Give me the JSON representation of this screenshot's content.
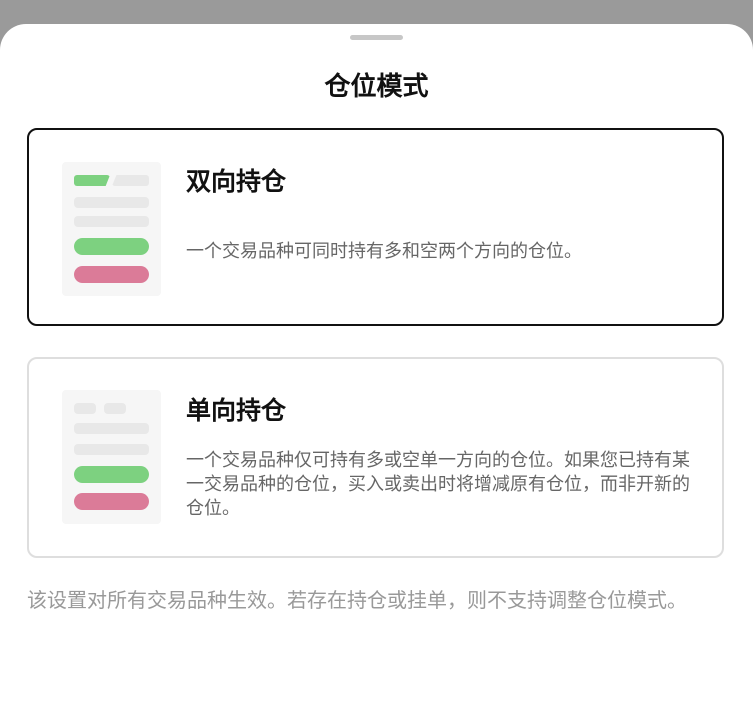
{
  "sheet": {
    "title": "仓位模式",
    "footnote": "该设置对所有交易品种生效。若存在持仓或挂单，则不支持调整仓位模式。"
  },
  "options": [
    {
      "title": "双向持仓",
      "description": "一个交易品种可同时持有多和空两个方向的仓位。",
      "selected": true
    },
    {
      "title": "单向持仓",
      "description": "一个交易品种仅可持有多或空单一方向的仓位。如果您已持有某一交易品种的仓位，买入或卖出时将增减原有仓位，而非开新的仓位。",
      "selected": false
    }
  ],
  "colors": {
    "selected_border": "#111111",
    "unselected_border": "#dedede",
    "long": "#7dd180",
    "short": "#db7b98",
    "placeholder": "#e8e8e8"
  }
}
